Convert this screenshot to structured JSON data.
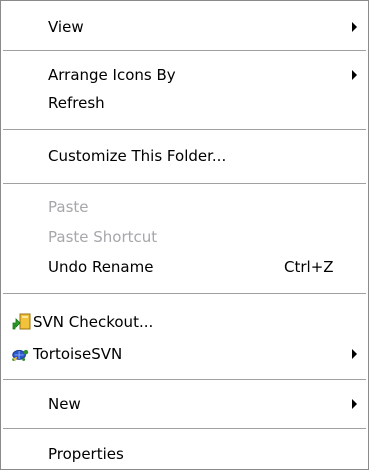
{
  "menu": {
    "view": "View",
    "arrange_icons_by": "Arrange Icons By",
    "refresh": "Refresh",
    "customize_folder": "Customize This Folder...",
    "paste": "Paste",
    "paste_shortcut": "Paste Shortcut",
    "undo_rename": "Undo Rename",
    "undo_rename_shortcut": "Ctrl+Z",
    "svn_checkout": "SVN Checkout...",
    "tortoisesvn": "TortoiseSVN",
    "new": "New",
    "properties": "Properties"
  },
  "icons": {
    "svn_checkout": "svn-checkout-icon",
    "tortoisesvn": "tortoisesvn-icon",
    "submenu": "submenu-arrow-icon"
  },
  "colors": {
    "disabled_text": "#a7a6aa",
    "separator": "#a0a0a0",
    "border": "#8a8a8a"
  }
}
